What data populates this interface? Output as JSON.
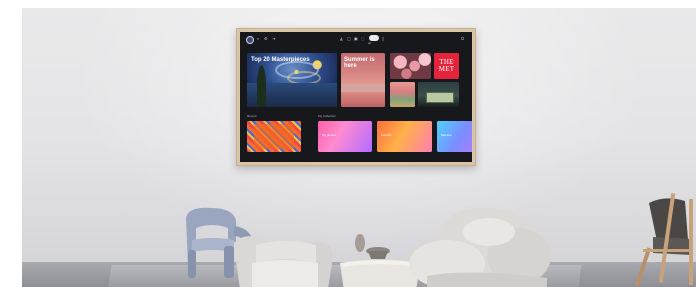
{
  "tv": {
    "mode_label": "Art",
    "top_icons": [
      "profile-icon",
      "search-icon",
      "settings-icon",
      "source-icon",
      "ambient-icon",
      "media-icon",
      "apps-icon",
      "art-icon",
      "game-icon",
      "power-icon"
    ],
    "featured": {
      "tile1_title": "Top 20 Masterpieces",
      "tile2_title": "Summer is here",
      "met_logo": "THE MET"
    },
    "section1_label": "Recent",
    "section2_label": "My Collection",
    "row2": {
      "tile2_label": "My photos",
      "tile3_label": "Favorite",
      "tile4_label": "Member"
    }
  },
  "colors": {
    "wall": "#e6e6e8",
    "tv_frame": "#d8c4a6",
    "screen": "#17181c",
    "met_red": "#e3243b"
  }
}
